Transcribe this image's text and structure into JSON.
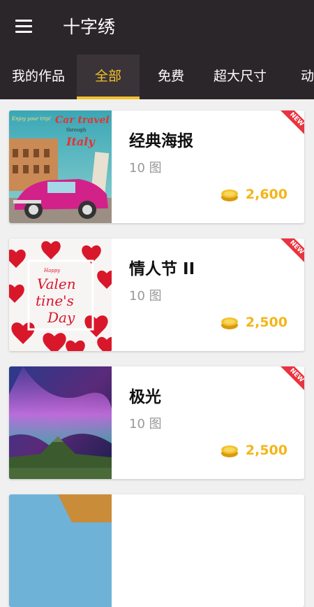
{
  "header": {
    "title": "十字绣",
    "menu_icon": "hamburger-menu-icon"
  },
  "tabs": [
    {
      "label": "我的作品",
      "active": false
    },
    {
      "label": "全部",
      "active": true
    },
    {
      "label": "免费",
      "active": false
    },
    {
      "label": "超大尺寸",
      "active": false
    },
    {
      "label": "动物",
      "active": false
    }
  ],
  "cards": [
    {
      "title": "经典海报",
      "count": "10 图",
      "price": "2,600",
      "badge": "NEW",
      "thumb_text": [
        "Enjoy your trip!",
        "Car travel",
        "through",
        "Italy"
      ]
    },
    {
      "title": "情人节 II",
      "count": "10 图",
      "price": "2,500",
      "badge": "NEW",
      "thumb_text": [
        "Happy",
        "Valen",
        "tine's",
        "Day"
      ]
    },
    {
      "title": "极光",
      "count": "10 图",
      "price": "2,500",
      "badge": "NEW"
    }
  ],
  "colors": {
    "bar": "#2b2629",
    "accent": "#f3c12b",
    "price": "#f3b619",
    "badge": "#e8343f"
  }
}
